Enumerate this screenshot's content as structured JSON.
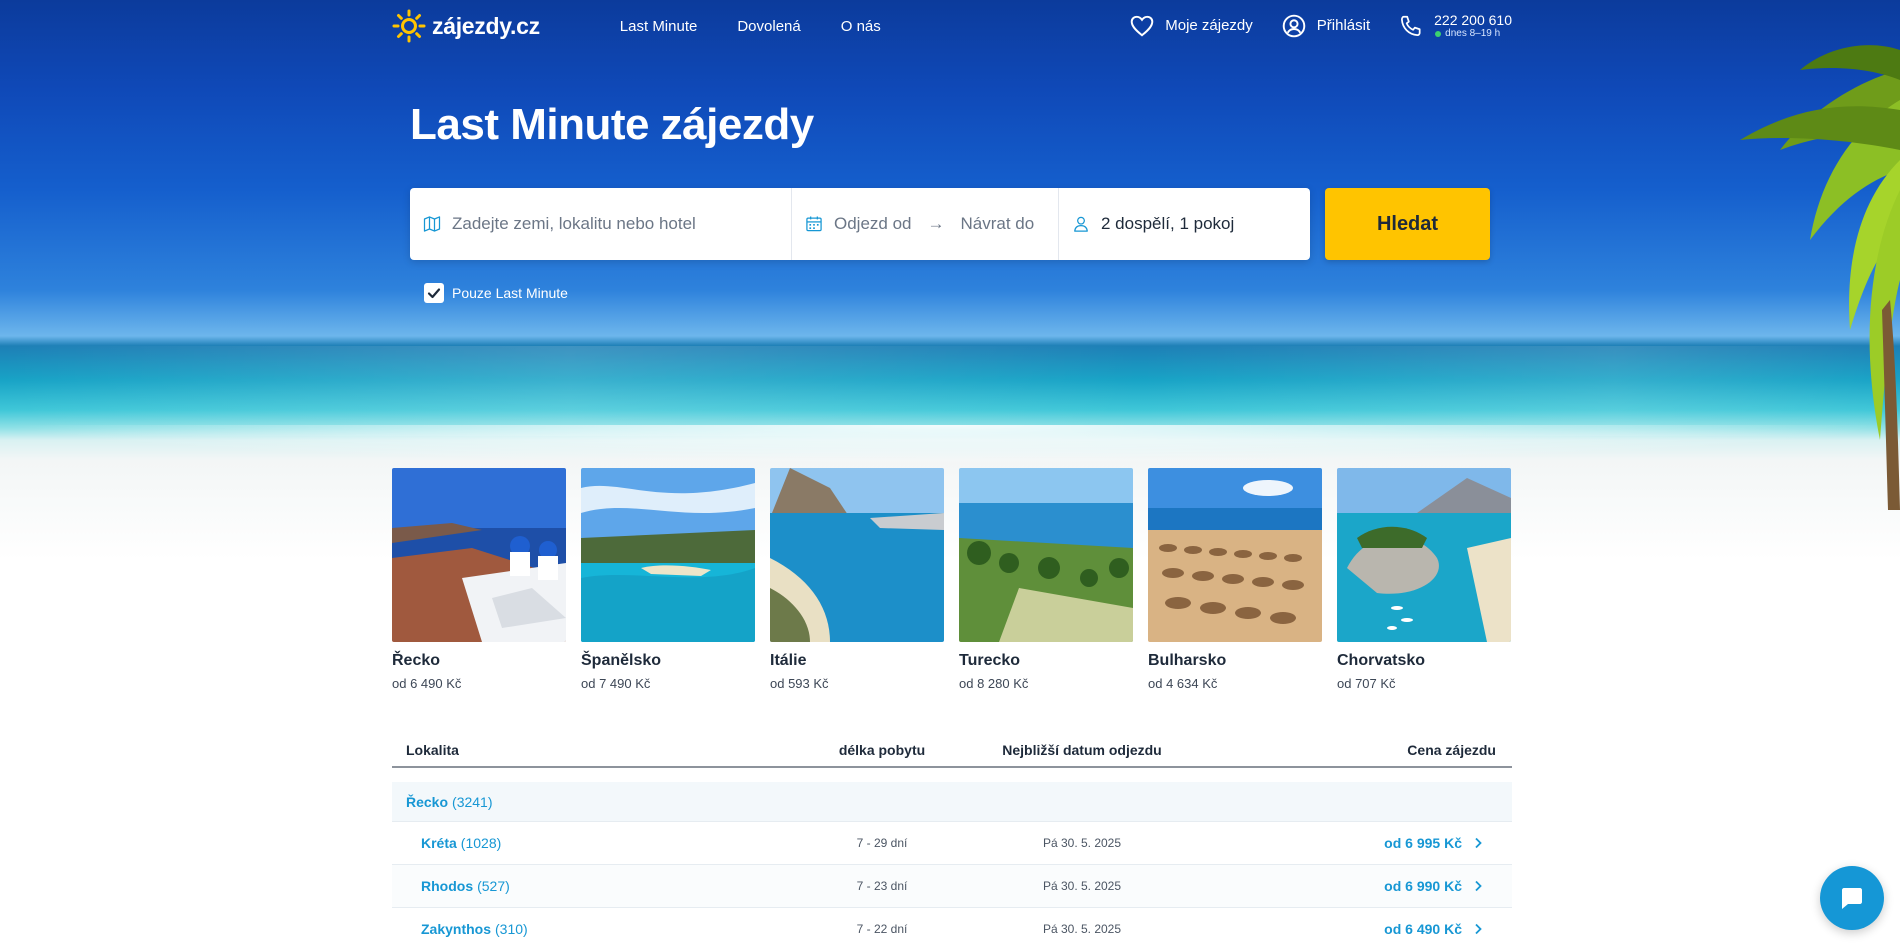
{
  "brand": {
    "logo_text": "zájezdy.cz"
  },
  "nav": {
    "items": [
      "Last Minute",
      "Dovolená",
      "O nás"
    ]
  },
  "header_actions": {
    "favorites_label": "Moje zájezdy",
    "login_label": "Přihlásit",
    "phone_number": "222 200 610",
    "phone_hours": "dnes 8–19 h"
  },
  "hero": {
    "title": "Last Minute zájezdy"
  },
  "search": {
    "destination_placeholder": "Zadejte zemi, lokalitu nebo hotel",
    "depart_placeholder": "Odjezd od",
    "return_placeholder": "Návrat do",
    "guests_value": "2 dospělí, 1 pokoj",
    "button_label": "Hledat",
    "last_minute_only_label": "Pouze Last Minute",
    "last_minute_only_checked": true
  },
  "destinations": [
    {
      "name": "Řecko",
      "price": "od 6 490 Kč"
    },
    {
      "name": "Španělsko",
      "price": "od 7 490 Kč"
    },
    {
      "name": "Itálie",
      "price": "od 593 Kč"
    },
    {
      "name": "Turecko",
      "price": "od 8 280 Kč"
    },
    {
      "name": "Bulharsko",
      "price": "od 4 634 Kč"
    },
    {
      "name": "Chorvatsko",
      "price": "od 707 Kč"
    }
  ],
  "table": {
    "headers": {
      "location": "Lokalita",
      "length": "délka pobytu",
      "date": "Nejbližší datum odjezdu",
      "price": "Cena zájezdu"
    },
    "group": {
      "name": "Řecko",
      "count": "(3241)"
    },
    "rows": [
      {
        "name": "Kréta",
        "count": "(1028)",
        "length": "7 - 29 dní",
        "date": "Pá 30. 5. 2025",
        "price": "od 6 995 Kč"
      },
      {
        "name": "Rhodos",
        "count": "(527)",
        "length": "7 - 23 dní",
        "date": "Pá 30. 5. 2025",
        "price": "od 6 990 Kč"
      },
      {
        "name": "Zakynthos",
        "count": "(310)",
        "length": "7 - 22 dní",
        "date": "Pá 30. 5. 2025",
        "price": "od 6 490 Kč"
      }
    ]
  },
  "colors": {
    "accent_yellow": "#ffc400",
    "link_blue": "#1797d4",
    "chat_blue": "#1597d6"
  },
  "icons": {
    "logo": "sun-icon",
    "favorites": "heart-icon",
    "login": "user-circle-icon",
    "phone": "phone-icon",
    "destination": "map-icon",
    "dates": "calendar-icon",
    "guests": "person-icon",
    "chat": "chat-bubble-icon"
  }
}
